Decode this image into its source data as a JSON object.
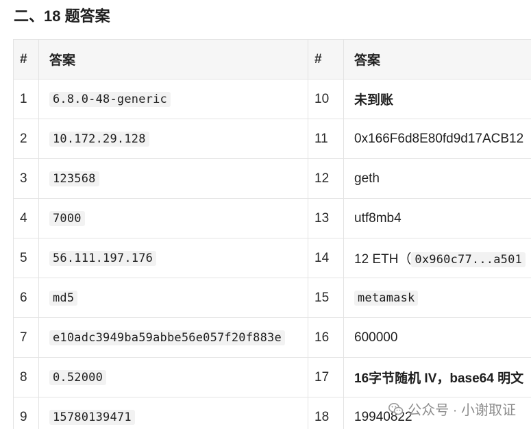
{
  "heading": "二、18 题答案",
  "table": {
    "headers": [
      "#",
      "答案",
      "#",
      "答案"
    ],
    "rows": [
      {
        "n1": "1",
        "a1": "6.8.0-48-generic",
        "n2": "10",
        "a2": "未到账"
      },
      {
        "n1": "2",
        "a1": "10.172.29.128",
        "n2": "11",
        "a2": "0x166F6d8E80fd9d17ACB12"
      },
      {
        "n1": "3",
        "a1": "123568",
        "n2": "12",
        "a2": "geth"
      },
      {
        "n1": "4",
        "a1": "7000",
        "n2": "13",
        "a2": "utf8mb4"
      },
      {
        "n1": "5",
        "a1": "56.111.197.176",
        "n2": "14",
        "a2_text": "12 ETH（",
        "a2_code": "0x960c77...a501"
      },
      {
        "n1": "6",
        "a1": "md5",
        "n2": "15",
        "a2": "metamask"
      },
      {
        "n1": "7",
        "a1": "e10adc3949ba59abbe56e057f20f883e",
        "n2": "16",
        "a2": "600000"
      },
      {
        "n1": "8",
        "a1": "0.52000",
        "n2": "17",
        "a2_text": "16字节随机 IV，base64 ",
        "a2_bold": "明文"
      },
      {
        "n1": "9",
        "a1": "15780139471",
        "n2": "18",
        "a2": "19940822"
      }
    ]
  },
  "watermark": "公众号 · 小谢取证",
  "watermark_icon": "wechat-logo-icon"
}
